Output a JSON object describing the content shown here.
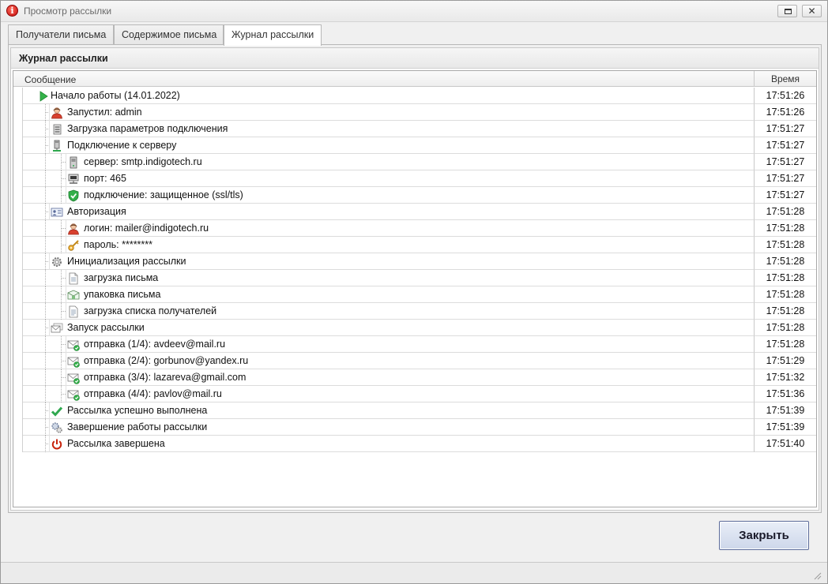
{
  "window": {
    "title": "Просмотр рассылки"
  },
  "tabs": [
    {
      "label": "Получатели письма"
    },
    {
      "label": "Содержимое письма"
    },
    {
      "label": "Журнал рассылки"
    }
  ],
  "group": {
    "title": "Журнал рассылки"
  },
  "grid": {
    "columns": {
      "message": "Сообщение",
      "time": "Время"
    },
    "rows": [
      {
        "level": 0,
        "icon": "play-icon",
        "text": "Начало работы (14.01.2022)",
        "time": "17:51:26"
      },
      {
        "level": 1,
        "icon": "user-icon",
        "text": "Запустил: admin",
        "time": "17:51:26"
      },
      {
        "level": 1,
        "icon": "settings-list-icon",
        "text": "Загрузка параметров подключения",
        "time": "17:51:27"
      },
      {
        "level": 1,
        "icon": "server-connect-icon",
        "text": "Подключение к серверу",
        "time": "17:51:27"
      },
      {
        "level": 2,
        "icon": "server-icon",
        "text": "сервер: smtp.indigotech.ru",
        "time": "17:51:27"
      },
      {
        "level": 2,
        "icon": "network-port-icon",
        "text": "порт: 465",
        "time": "17:51:27"
      },
      {
        "level": 2,
        "icon": "shield-check-icon",
        "text": "подключение: защищенное (ssl/tls)",
        "time": "17:51:27"
      },
      {
        "level": 1,
        "icon": "id-card-icon",
        "text": "Авторизация",
        "time": "17:51:28"
      },
      {
        "level": 2,
        "icon": "user-icon",
        "text": "логин: mailer@indigotech.ru",
        "time": "17:51:28"
      },
      {
        "level": 2,
        "icon": "key-icon",
        "text": "пароль: ********",
        "time": "17:51:28"
      },
      {
        "level": 1,
        "icon": "gear-icon",
        "text": "Инициализация рассылки",
        "time": "17:51:28"
      },
      {
        "level": 2,
        "icon": "document-icon",
        "text": "загрузка письма",
        "time": "17:51:28"
      },
      {
        "level": 2,
        "icon": "package-icon",
        "text": "упаковка письма",
        "time": "17:51:28"
      },
      {
        "level": 2,
        "icon": "document-list-icon",
        "text": "загрузка списка получателей",
        "time": "17:51:28"
      },
      {
        "level": 1,
        "icon": "mail-stack-icon",
        "text": "Запуск рассылки",
        "time": "17:51:28"
      },
      {
        "level": 2,
        "icon": "mail-sent-icon",
        "text": "отправка (1/4): avdeev@mail.ru",
        "time": "17:51:28"
      },
      {
        "level": 2,
        "icon": "mail-sent-icon",
        "text": "отправка (2/4): gorbunov@yandex.ru",
        "time": "17:51:29"
      },
      {
        "level": 2,
        "icon": "mail-sent-icon",
        "text": "отправка (3/4): lazareva@gmail.com",
        "time": "17:51:32"
      },
      {
        "level": 2,
        "icon": "mail-sent-icon",
        "text": "отправка (4/4): pavlov@mail.ru",
        "time": "17:51:36"
      },
      {
        "level": 1,
        "icon": "check-icon",
        "text": "Рассылка успешно выполнена",
        "time": "17:51:39"
      },
      {
        "level": 1,
        "icon": "gears-icon",
        "text": "Завершение работы рассылки",
        "time": "17:51:39"
      },
      {
        "level": 1,
        "icon": "power-icon",
        "text": "Рассылка завершена",
        "time": "17:51:40"
      }
    ]
  },
  "buttons": {
    "close_label": "Закрыть"
  },
  "colors": {
    "accent": "#2fa84f",
    "danger": "#c40d0d",
    "button_border": "#5a6a9a"
  }
}
